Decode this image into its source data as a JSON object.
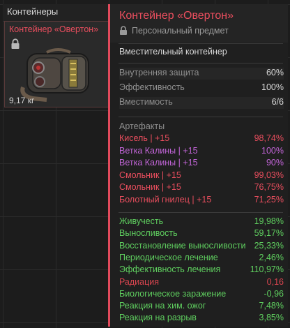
{
  "inventory": {
    "title": "Контейнеры",
    "item": {
      "name": "Контейнер «Овертон»",
      "weight": "9,17 кг",
      "accent": "#ea4e5e"
    }
  },
  "tooltip": {
    "title": "Контейнер «Овертон»",
    "subtitle": "Персональный предмет",
    "description": "Вместительный контейнер",
    "stats": [
      {
        "label": "Внутренняя защита",
        "value": "60%"
      },
      {
        "label": "Эффективность",
        "value": "100%"
      },
      {
        "label": "Вместимость",
        "value": "6/6"
      }
    ],
    "artifacts_title": "Артефакты",
    "artifacts": [
      {
        "label": "Кисель | +15",
        "value": "98,74%",
        "color": "#ea4e5e"
      },
      {
        "label": "Ветка Калины | +15",
        "value": "100%",
        "color": "#c265d8"
      },
      {
        "label": "Ветка Калины | +15",
        "value": "90%",
        "color": "#c265d8"
      },
      {
        "label": "Смольник | +15",
        "value": "99,03%",
        "color": "#ea4e5e"
      },
      {
        "label": "Смольник | +15",
        "value": "76,75%",
        "color": "#ea4e5e"
      },
      {
        "label": "Болотный гнилец | +15",
        "value": "71,25%",
        "color": "#ea4e5e"
      }
    ],
    "effects": [
      {
        "label": "Живучесть",
        "value": "19,98%",
        "color": "#5fcf5f"
      },
      {
        "label": "Выносливость",
        "value": "59,17%",
        "color": "#5fcf5f"
      },
      {
        "label": "Восстановление выносливости",
        "value": "25,33%",
        "color": "#5fcf5f"
      },
      {
        "label": "Периодическое лечение",
        "value": "2,46%",
        "color": "#5fcf5f"
      },
      {
        "label": "Эффективность лечения",
        "value": "110,97%",
        "color": "#5fcf5f"
      },
      {
        "label": "Радиация",
        "value": "0,16",
        "color": "#d8454f"
      },
      {
        "label": "Биологическое заражение",
        "value": "-0,96",
        "color": "#5fcf5f"
      },
      {
        "label": "Реакция на хим. ожог",
        "value": "7,48%",
        "color": "#5fcf5f"
      },
      {
        "label": "Реакция на разрыв",
        "value": "3,85%",
        "color": "#5fcf5f"
      }
    ]
  }
}
